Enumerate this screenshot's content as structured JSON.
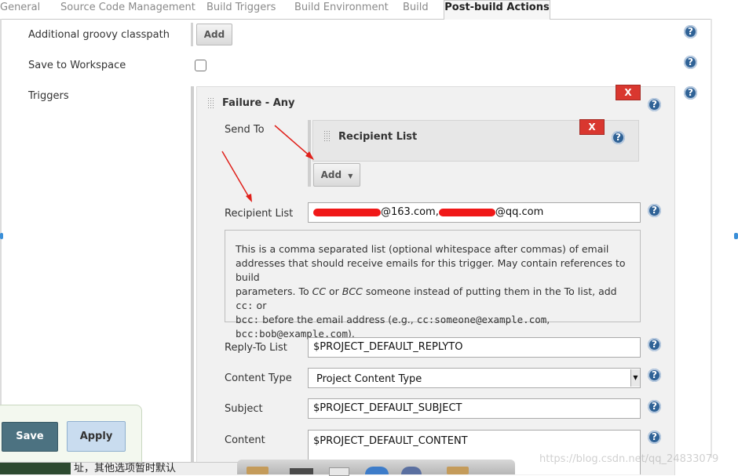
{
  "tabs": [
    "General",
    "Source Code Management",
    "Build Triggers",
    "Build Environment",
    "Build",
    "Post-build Actions"
  ],
  "groovy": {
    "label": "Additional groovy classpath",
    "add": "Add"
  },
  "workspace": {
    "label": "Save to Workspace"
  },
  "triggers": {
    "label": "Triggers"
  },
  "trigger": {
    "title": "Failure - Any",
    "delete": "X",
    "send_to_label": "Send To",
    "recipient_block": {
      "title": "Recipient List",
      "delete": "X"
    },
    "add_label": "Add",
    "recipient_list_label": "Recipient List",
    "recipient_list_value_a": "@163.com,",
    "recipient_list_value_b": "@qq.com",
    "help": {
      "line1": "This is a comma separated list (optional whitespace after commas) of email",
      "line2": "addresses that should receive emails for this trigger. May contain references to build",
      "line3a": "parameters. To ",
      "cc": "CC",
      "or": " or ",
      "bcc": "BCC",
      "line3b": " someone instead of putting them in the To list, add ",
      "cc_code": "cc:",
      "or2": " or",
      "bcc_code": "bcc:",
      "line4b": " before the email address (e.g., ",
      "ex1": "cc:someone@example.com",
      "comma": ",",
      "ex2": "bcc:bob@example.com",
      "end": ")."
    },
    "reply_to": {
      "label": "Reply-To List",
      "value": "$PROJECT_DEFAULT_REPLYTO"
    },
    "content_type": {
      "label": "Content Type",
      "value": "Project Content Type"
    },
    "subject": {
      "label": "Subject",
      "value": "$PROJECT_DEFAULT_SUBJECT"
    },
    "content": {
      "label": "Content",
      "value": "$PROJECT_DEFAULT_CONTENT"
    }
  },
  "footer": {
    "save": "Save",
    "apply": "Apply"
  },
  "ime_text": "址，其他选项暂时默认",
  "watermark": "https://blog.csdn.net/qq_24833079",
  "colors": {
    "help_icon": "#2f6296",
    "delete": "#d9372f",
    "save": "#4c7281",
    "apply": "#c9dcef",
    "annotation_arrow": "#e0201a"
  }
}
